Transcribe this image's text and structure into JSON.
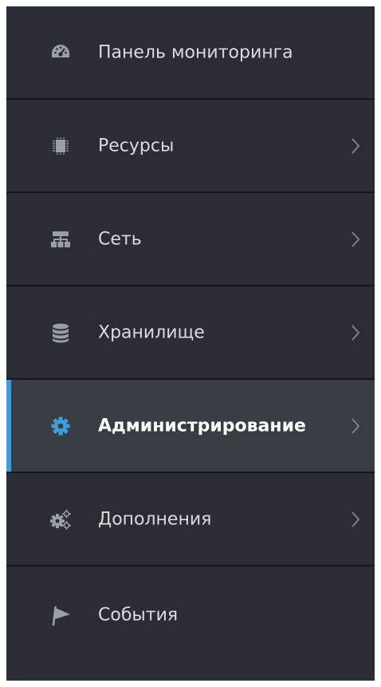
{
  "colors": {
    "sidebar_bg": "#2a2d33",
    "active_bg": "#383c43",
    "accent": "#3aa0dd",
    "divider": "#141619",
    "icon": "#9a9ea6",
    "label": "#d9dbdf"
  },
  "nav": {
    "items": [
      {
        "label": "Панель мониторинга",
        "icon": "dashboard-gauge-icon",
        "has_submenu": false
      },
      {
        "label": "Ресурсы",
        "icon": "cpu-chip-icon",
        "has_submenu": true
      },
      {
        "label": "Сеть",
        "icon": "network-icon",
        "has_submenu": true
      },
      {
        "label": "Хранилище",
        "icon": "database-icon",
        "has_submenu": true
      },
      {
        "label": "Администрирование",
        "icon": "gear-icon",
        "has_submenu": true,
        "active": true
      },
      {
        "label": "Дополнения",
        "icon": "gears-icon",
        "has_submenu": true
      },
      {
        "label": "События",
        "icon": "flag-icon",
        "has_submenu": false
      }
    ]
  }
}
